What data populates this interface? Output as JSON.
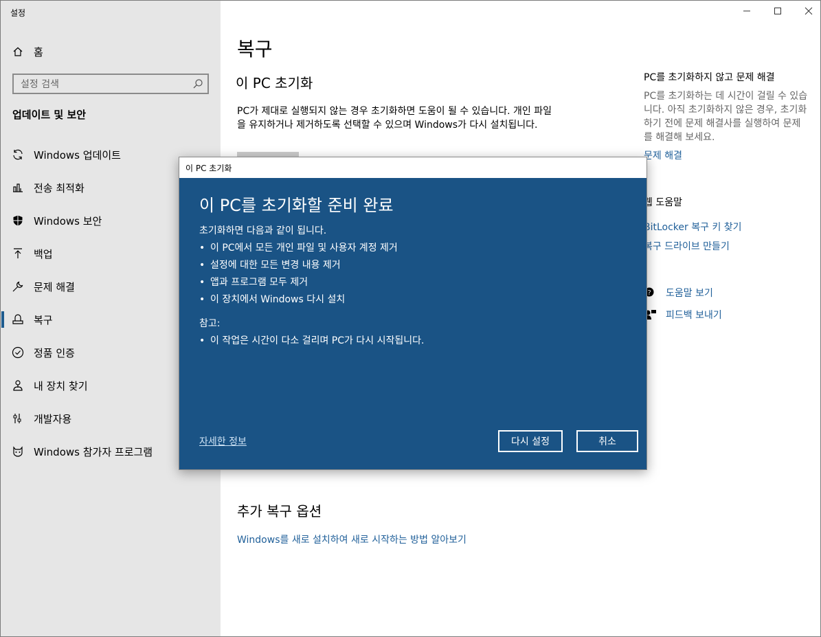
{
  "window": {
    "title": "설정",
    "controls": [
      "minimize-icon",
      "maximize-icon",
      "close-icon"
    ]
  },
  "sidebar": {
    "home_label": "홈",
    "search_placeholder": "설정 검색",
    "section_heading": "업데이트 및 보안",
    "items": [
      {
        "label": "Windows 업데이트",
        "icon": "sync-icon"
      },
      {
        "label": "전송 최적화",
        "icon": "delivery-optimization-icon"
      },
      {
        "label": "Windows 보안",
        "icon": "shield-icon"
      },
      {
        "label": "백업",
        "icon": "backup-arrow-icon"
      },
      {
        "label": "문제 해결",
        "icon": "wrench-icon"
      },
      {
        "label": "복구",
        "icon": "recovery-icon",
        "active": true
      },
      {
        "label": "정품 인증",
        "icon": "checkmark-circle-icon"
      },
      {
        "label": "내 장치 찾기",
        "icon": "find-device-icon"
      },
      {
        "label": "개발자용",
        "icon": "developer-sliders-icon"
      },
      {
        "label": "Windows 참가자 프로그램",
        "icon": "insider-cat-icon"
      }
    ]
  },
  "main": {
    "title": "복구",
    "reset_heading": "이 PC 초기화",
    "reset_description": "PC가 제대로 실행되지 않는 경우 초기화하면 도움이 될 수 있습니다. 개인 파일을 유지하거나 제거하도록 선택할 수 있으며 Windows가 다시 설치됩니다.",
    "more_options_heading": "추가 복구 옵션",
    "more_options_link": "Windows를 새로 설치하여 새로 시작하는 방법 알아보기"
  },
  "right": {
    "troubleshoot_title": "PC를 초기화하지 않고 문제 해결",
    "troubleshoot_desc": "PC를 초기화하는 데 시간이 걸릴 수 있습니다. 아직 초기화하지 않은 경우, 초기화하기 전에 문제 해결사를 실행하여 문제를 해결해 보세요.",
    "troubleshoot_link": "문제 해결",
    "web_help_title": "웹 도움말",
    "links": [
      "BitLocker 복구 키 찾기",
      "복구 드라이브 만들기"
    ],
    "get_help": "도움말 보기",
    "give_feedback": "피드백 보내기"
  },
  "dialog": {
    "window_title": "이 PC 초기화",
    "heading": "이 PC를 초기화할 준비 완료",
    "intro": "초기화하면 다음과 같이 됩니다.",
    "bullets": [
      "이 PC에서 모든 개인 파일 및 사용자 계정 제거",
      "설정에 대한 모든 변경 내용 제거",
      "앱과 프로그램 모두 제거",
      "이 장치에서 Windows 다시 설치"
    ],
    "note_label": "참고:",
    "note_bullets": [
      "이 작업은 시간이 다소 걸리며 PC가 다시 시작됩니다."
    ],
    "more_info_link": "자세한 정보",
    "reset_button": "다시 설정",
    "cancel_button": "취소"
  },
  "colors": {
    "accent": "#1a5385",
    "link": "#1f5f99",
    "sidebar_bg": "#e6e6e6"
  }
}
